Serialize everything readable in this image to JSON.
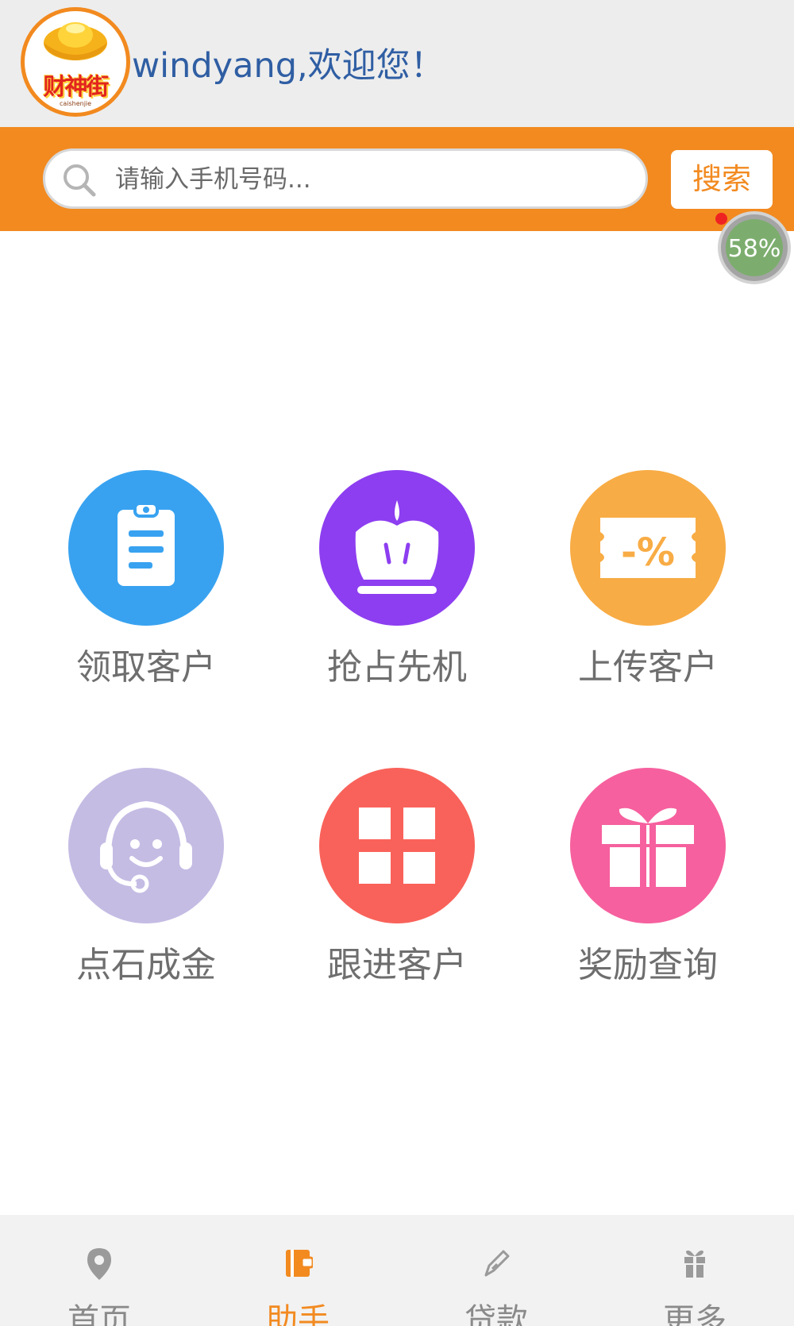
{
  "header": {
    "logo_text": "财神街",
    "logo_subtext": "caishenjie",
    "welcome": "windyang,欢迎您！"
  },
  "search": {
    "placeholder": "请输入手机号码...",
    "button_label": "搜索"
  },
  "float_badge": {
    "percent_text": "58%"
  },
  "grid": [
    {
      "label": "领取客户",
      "icon": "clipboard-icon",
      "color": "#38a2f0"
    },
    {
      "label": "抢占先机",
      "icon": "crown-icon",
      "color": "#8d3ef0"
    },
    {
      "label": "上传客户",
      "icon": "coupon-icon",
      "color": "#f8ac45"
    },
    {
      "label": "点石成金",
      "icon": "headset-smile-icon",
      "color": "#c5bce4"
    },
    {
      "label": "跟进客户",
      "icon": "grid-icon",
      "color": "#f9625a"
    },
    {
      "label": "奖励查询",
      "icon": "gift-icon",
      "color": "#f6609e"
    }
  ],
  "nav": [
    {
      "label": "首页",
      "icon": "location-pin-icon",
      "active": false
    },
    {
      "label": "助手",
      "icon": "notebook-icon",
      "active": true
    },
    {
      "label": "贷款",
      "icon": "pen-icon",
      "active": false
    },
    {
      "label": "更多",
      "icon": "gift-icon",
      "active": false
    }
  ],
  "colors": {
    "accent": "#f28a20",
    "active_nav": "#f28a20",
    "welcome_text": "#2f5ea3"
  }
}
